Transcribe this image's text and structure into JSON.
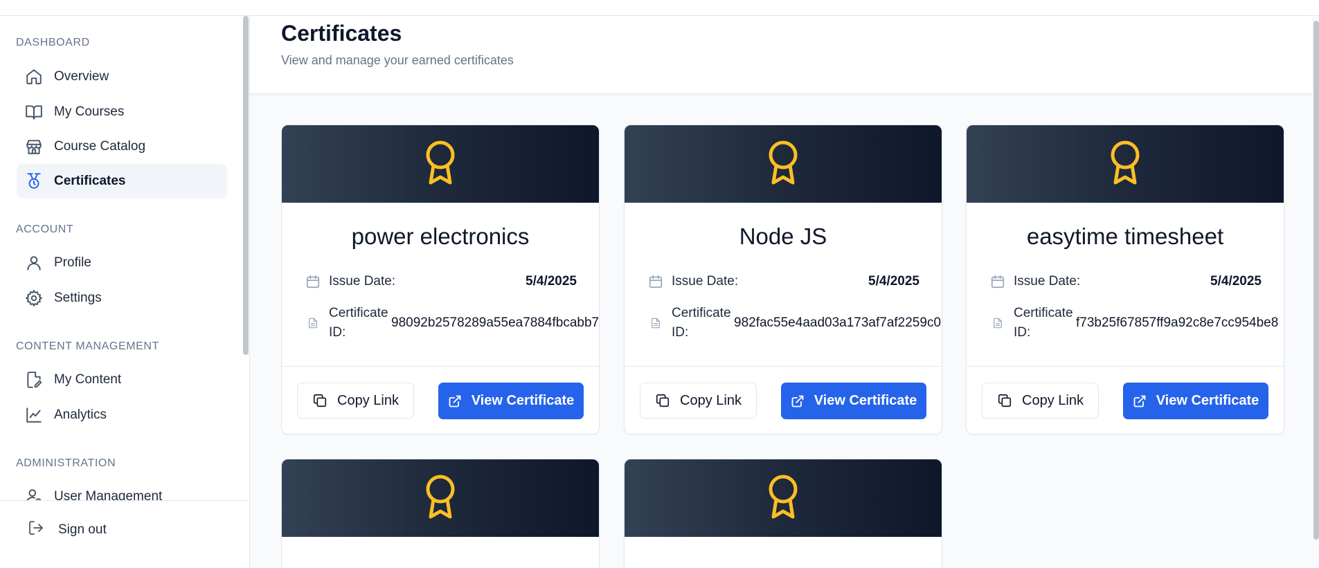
{
  "sidebar": {
    "sections": [
      {
        "label": "DASHBOARD",
        "items": [
          {
            "label": "Overview",
            "icon": "home-icon"
          },
          {
            "label": "My Courses",
            "icon": "book-open-icon"
          },
          {
            "label": "Course Catalog",
            "icon": "store-icon"
          },
          {
            "label": "Certificates",
            "icon": "medal-icon",
            "active": true
          }
        ]
      },
      {
        "label": "ACCOUNT",
        "items": [
          {
            "label": "Profile",
            "icon": "user-icon"
          },
          {
            "label": "Settings",
            "icon": "gear-icon"
          }
        ]
      },
      {
        "label": "CONTENT MANAGEMENT",
        "items": [
          {
            "label": "My Content",
            "icon": "file-edit-icon"
          },
          {
            "label": "Analytics",
            "icon": "chart-line-icon"
          }
        ]
      },
      {
        "label": "ADMINISTRATION",
        "items": [
          {
            "label": "User Management",
            "icon": "user-cog-icon"
          }
        ]
      }
    ],
    "sign_out": "Sign out"
  },
  "header": {
    "title": "Certificates",
    "subtitle": "View and manage your earned certificates"
  },
  "certificates": [
    {
      "title": "power electronics",
      "issue_label": "Issue Date:",
      "issue_date": "5/4/2025",
      "id_label": "Certificate ID:",
      "id": "98092b2578289a55ea7884fbcabb7",
      "copy_label": "Copy Link",
      "view_label": "View Certificate"
    },
    {
      "title": "Node JS",
      "issue_label": "Issue Date:",
      "issue_date": "5/4/2025",
      "id_label": "Certificate ID:",
      "id": "982fac55e4aad03a173af7af2259c0",
      "copy_label": "Copy Link",
      "view_label": "View Certificate"
    },
    {
      "title": "easytime timesheet",
      "issue_label": "Issue Date:",
      "issue_date": "5/4/2025",
      "id_label": "Certificate ID:",
      "id": "f73b25f67857ff9a92c8e7cc954be8",
      "copy_label": "Copy Link",
      "view_label": "View Certificate"
    },
    {
      "title": "",
      "partial": true
    },
    {
      "title": "",
      "partial": true
    }
  ],
  "colors": {
    "accent": "#2563eb",
    "award": "#fbbf24",
    "banner_from": "#334155",
    "banner_to": "#0f172a"
  }
}
